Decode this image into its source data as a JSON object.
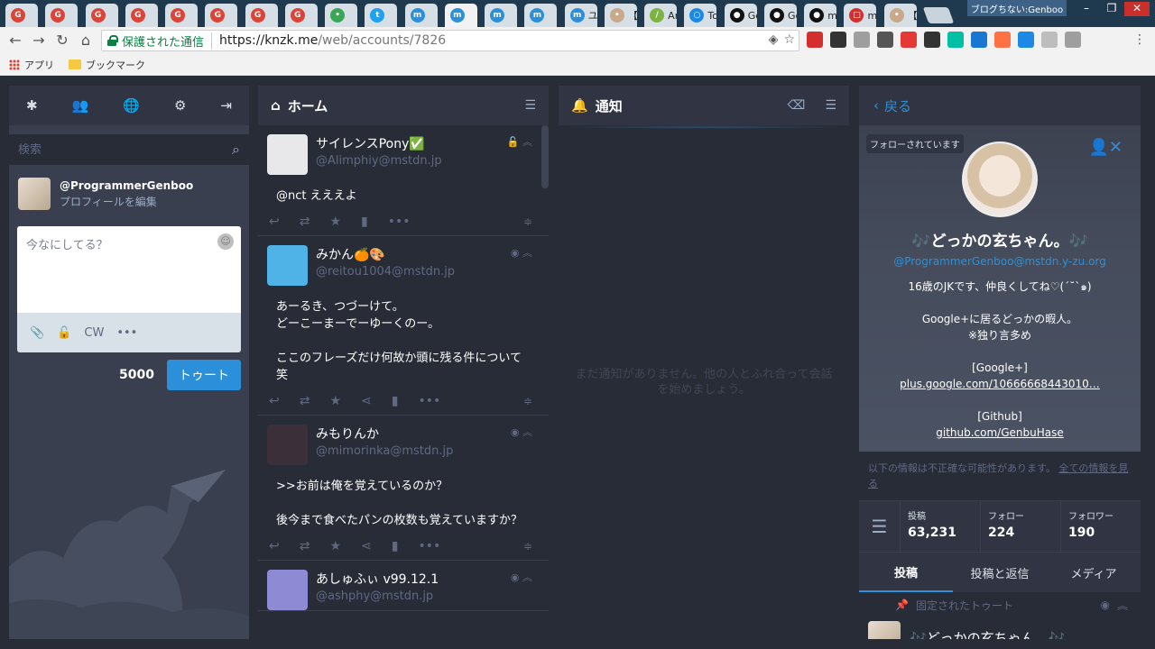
{
  "browser": {
    "tabs": [
      {
        "label": "",
        "fav_bg": "#db4437",
        "fav_glyph": "G"
      },
      {
        "label": "",
        "fav_bg": "#db4437",
        "fav_glyph": "G"
      },
      {
        "label": "",
        "fav_bg": "#db4437",
        "fav_glyph": "G"
      },
      {
        "label": "",
        "fav_bg": "#db4437",
        "fav_glyph": "G"
      },
      {
        "label": "",
        "fav_bg": "#db4437",
        "fav_glyph": "G"
      },
      {
        "label": "",
        "fav_bg": "#db4437",
        "fav_glyph": "G"
      },
      {
        "label": "",
        "fav_bg": "#db4437",
        "fav_glyph": "G"
      },
      {
        "label": "",
        "fav_bg": "#db4437",
        "fav_glyph": "G"
      },
      {
        "label": "",
        "fav_bg": "#3aa757",
        "fav_glyph": "•"
      },
      {
        "label": "",
        "fav_bg": "#1da1f2",
        "fav_glyph": "t"
      },
      {
        "label": "",
        "fav_bg": "#2b90d9",
        "fav_glyph": "m"
      },
      {
        "label": "",
        "fav_bg": "#2b90d9",
        "fav_glyph": "m"
      },
      {
        "label": "",
        "fav_bg": "#2b90d9",
        "fav_glyph": "m"
      },
      {
        "label": "",
        "fav_bg": "#2b90d9",
        "fav_glyph": "m"
      },
      {
        "label": "ユー",
        "fav_bg": "#2b90d9",
        "fav_glyph": "m"
      },
      {
        "label": "【Ma",
        "fav_bg": "#c9a98a",
        "fav_glyph": "•"
      },
      {
        "label": "Arti",
        "fav_bg": "#7cb342",
        "fav_glyph": "/"
      },
      {
        "label": "Toc",
        "fav_bg": "#1e88e5",
        "fav_glyph": "○"
      },
      {
        "label": "Ge",
        "fav_bg": "#111111",
        "fav_glyph": "●"
      },
      {
        "label": "Ge",
        "fav_bg": "#111111",
        "fav_glyph": "●"
      },
      {
        "label": "ma",
        "fav_bg": "#111111",
        "fav_glyph": "●"
      },
      {
        "label": "ma",
        "fav_bg": "#d32f2f",
        "fav_glyph": "□"
      },
      {
        "label": "【M",
        "fav_bg": "#c9a98a",
        "fav_glyph": "•"
      }
    ],
    "profile_badge": "ブログちない:Genboo",
    "secure_label": "保護された通信",
    "url_host": "https://knzk.me",
    "url_path": "/web/accounts/7826",
    "ext_colors": [
      "#d32f2f",
      "#333333",
      "#9e9e9e",
      "#555555",
      "#e53935",
      "#333333",
      "#00bfa5",
      "#1976d2",
      "#ff7043",
      "#1e88e5",
      "#bdbdbd",
      "#9e9e9e"
    ],
    "bookmarks": {
      "apps": "アプリ",
      "folder": "ブックマーク"
    }
  },
  "compose": {
    "search_placeholder": "検索",
    "account_acct": "@ProgrammerGenboo",
    "edit_profile": "プロフィールを編集",
    "textarea_placeholder": "今なにしてる？",
    "cw_label": "CW",
    "char_count": "5000",
    "toot_label": "トゥート"
  },
  "home": {
    "title": "ホーム",
    "statuses": [
      {
        "display_name": "サイレンスPony✅",
        "acct": "@Alimphiy@mstdn.jp",
        "content": "@nct えええよ",
        "avatar_bg": "#e8e8ea",
        "corner": "🔓 ︽"
      },
      {
        "display_name": "みかん🍊🎨",
        "acct": "@reitou1004@mstdn.jp",
        "content": "あーるき、つづーけて。\nどーこーまーでーゆーくのー。\n\nここのフレーズだけ何故か頭に残る件について笑",
        "avatar_bg": "#4fb3e8",
        "corner": "◉ ︽"
      },
      {
        "display_name": "みもりんか",
        "acct": "@mimorinka@mstdn.jp",
        "content": ">>お前は俺を覚えているのか？\n\n後今まで食べたパンの枚数も覚えていますか？",
        "avatar_bg": "#3b2f3a",
        "corner": "◉ ︽"
      },
      {
        "display_name": "あしゅふぃ v99.12.1",
        "acct": "@ashphy@mstdn.jp",
        "content": "",
        "avatar_bg": "#8e8bd4",
        "corner": "◉ ︽"
      }
    ]
  },
  "notifications": {
    "title": "通知",
    "empty_message": "まだ通知がありません。他の人とふれ合って会話を始めましょう。"
  },
  "profile": {
    "back_label": "戻る",
    "follows_you": "フォローされています",
    "display_name": "🎶どっかの玄ちゃん。🎶",
    "acct": "@ProgrammerGenboo@mstdn.y-zu.org",
    "note_line1": "16歳のJKです、仲良くしてね♡(´˘`๑)",
    "note_line2": "Google+に居るどっかの暇人。",
    "note_line3": "※独り言多め",
    "note_gplus_label": "[Google+]",
    "note_gplus_link": "plus.google.com/10666668443010…",
    "note_github_label": "[Github]",
    "note_github_link": "github.com/GenbuHase",
    "meta_warning": "以下の情報は不正確な可能性があります。",
    "meta_warning_link": "全ての情報を見る",
    "counters": [
      {
        "label": "投稿",
        "value": "63,231"
      },
      {
        "label": "フォロー",
        "value": "224"
      },
      {
        "label": "フォロワー",
        "value": "190"
      }
    ],
    "tabs": [
      "投稿",
      "投稿と返信",
      "メディア"
    ],
    "pinned_label": "固定されたトゥート",
    "pinned_name": "🎶どっかの玄ちゃん。🎶"
  }
}
